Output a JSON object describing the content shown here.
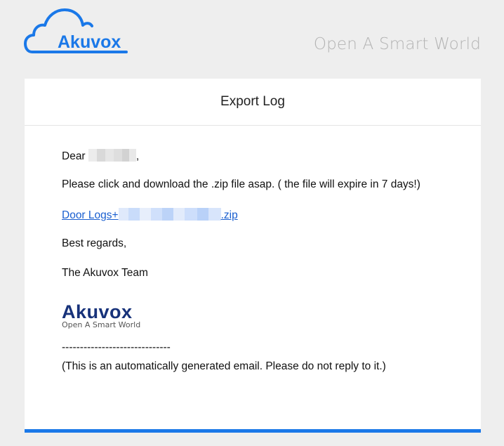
{
  "brand": {
    "name": "Akuvox",
    "tagline": "Open A Smart World",
    "color": "#1a78e8"
  },
  "email": {
    "title": "Export Log",
    "greeting_prefix": "Dear ",
    "greeting_suffix": ",",
    "message": "Please click and download the .zip file asap. ( the file will expire in 7 days!)",
    "link_prefix": "Door Logs+",
    "link_suffix": ".zip",
    "closing": "Best regards,",
    "signature": "The Akuvox Team",
    "footer_logo_name": "Akuvox",
    "footer_logo_tagline": "Open A Smart World",
    "divider": "------------------------------",
    "notice": "(This is an automatically generated email. Please do not reply to it.)"
  }
}
